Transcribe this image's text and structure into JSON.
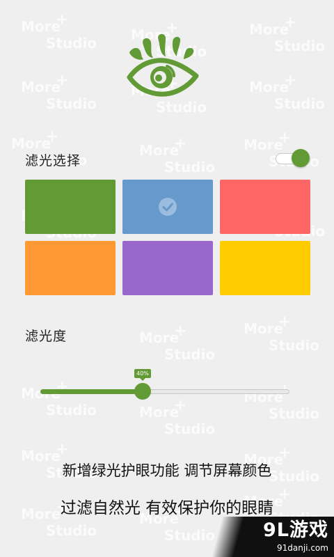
{
  "watermark": {
    "line1": "More",
    "plus": "+",
    "line2": "Studio"
  },
  "colors": {
    "accent": "#629a36"
  },
  "filter_section": {
    "label": "滤光选择",
    "toggle_on": true
  },
  "swatches": [
    {
      "color": "#629a36",
      "selected": false
    },
    {
      "color": "#6699cc",
      "selected": true
    },
    {
      "color": "#ff6666",
      "selected": false
    },
    {
      "color": "#ff9933",
      "selected": false
    },
    {
      "color": "#9966cc",
      "selected": false
    },
    {
      "color": "#ffcc00",
      "selected": false
    }
  ],
  "level_section": {
    "label": "滤光度",
    "value_label": "40%",
    "value": 0.4
  },
  "captions": {
    "line1": "新增绿光护眼功能 调节屏幕颜色",
    "line2": "过滤自然光 有效保护你的眼睛"
  },
  "corner_brand": {
    "logo": "9L游戏",
    "url": "91danji.com"
  }
}
